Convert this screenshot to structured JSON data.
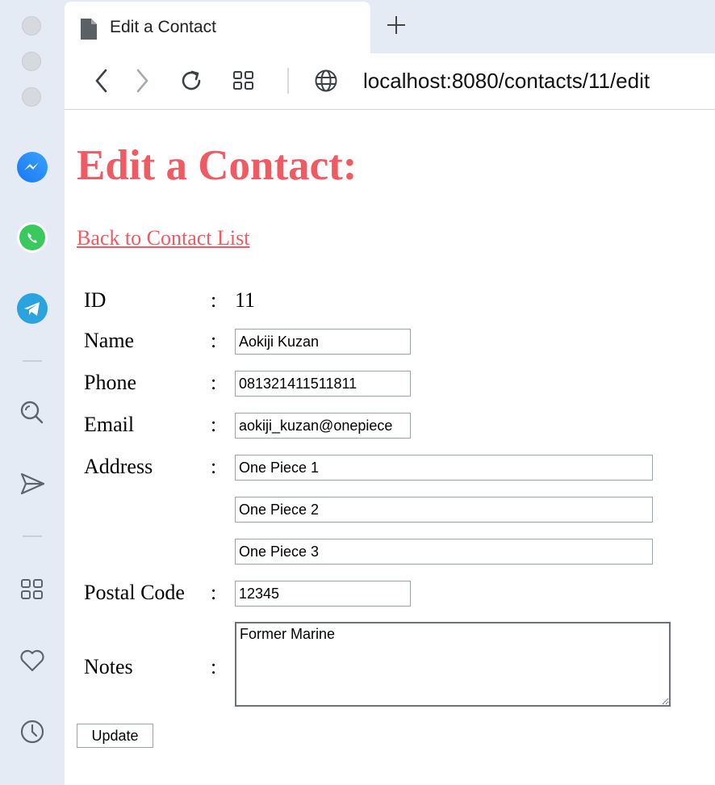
{
  "browser": {
    "tab_title": "Edit a Contact",
    "url": "localhost:8080/contacts/11/edit"
  },
  "sidebar": {
    "icons": [
      "messenger-icon",
      "whatsapp-icon",
      "telegram-icon",
      "search-icon",
      "send-icon",
      "apps-icon",
      "heart-icon",
      "history-icon"
    ]
  },
  "page": {
    "title": "Edit a Contact:",
    "back_link": "Back to Contact List"
  },
  "form": {
    "id_label": "ID",
    "id_value": "11",
    "name_label": "Name",
    "name_value": "Aokiji Kuzan",
    "phone_label": "Phone",
    "phone_value": "081321411511811",
    "email_label": "Email",
    "email_value": "aokiji_kuzan@onepiece",
    "address_label": "Address",
    "address1": "One Piece 1",
    "address2": "One Piece 2",
    "address3": "One Piece 3",
    "postal_label": "Postal Code",
    "postal_value": "12345",
    "notes_label": "Notes",
    "notes_value": "Former Marine",
    "colon": ":",
    "submit_label": "Update"
  },
  "colors": {
    "accent": "#f05a63",
    "sidebar_bg": "#e4ebf4"
  }
}
